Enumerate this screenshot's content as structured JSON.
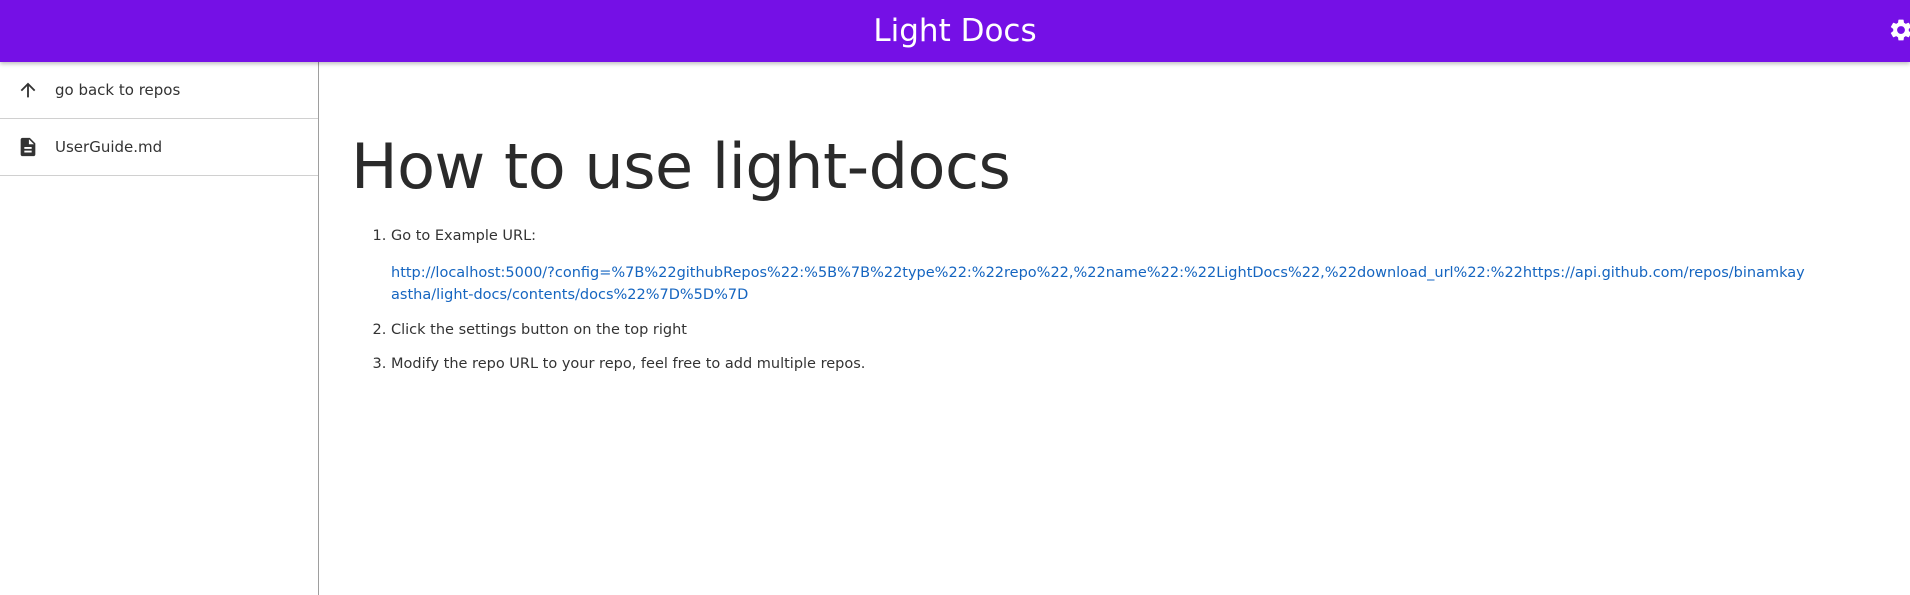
{
  "app": {
    "title": "Light Docs"
  },
  "colors": {
    "appbar": "#7510e6",
    "link": "#1565c0"
  },
  "header": {
    "settings_icon": "gear-icon"
  },
  "sidebar": {
    "items": [
      {
        "label": "go back to repos",
        "icon": "arrow-up-icon"
      },
      {
        "label": "UserGuide.md",
        "icon": "document-icon"
      }
    ]
  },
  "document": {
    "title": "How to use light-docs",
    "steps": [
      "Go to Example URL:",
      "Click the settings button on the top right",
      "Modify the repo URL to your repo, feel free to add multiple repos."
    ],
    "example_url": "http://localhost:5000/?config=%7B%22githubRepos%22:%5B%7B%22type%22:%22repo%22,%22name%22:%22LightDocs%22,%22download_url%22:%22https://api.github.com/repos/binamkayastha/light-docs/contents/docs%22%7D%5D%7D"
  }
}
